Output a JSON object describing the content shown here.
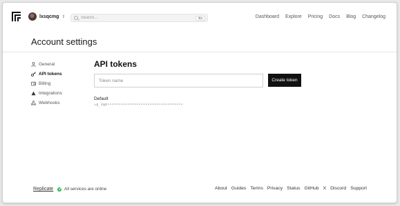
{
  "nav": {
    "username": "lxsqcmg",
    "search_placeholder": "Search...",
    "search_shortcut": "⌘K",
    "links": [
      "Dashboard",
      "Explore",
      "Pricing",
      "Docs",
      "Blog",
      "Changelog"
    ]
  },
  "page": {
    "title": "Account settings"
  },
  "sidebar": {
    "items": [
      {
        "label": "General",
        "icon": "user-icon",
        "active": false
      },
      {
        "label": "API tokens",
        "icon": "key-icon",
        "active": true
      },
      {
        "label": "Billing",
        "icon": "wallet-icon",
        "active": false
      },
      {
        "label": "Integrations",
        "icon": "triangle-icon",
        "active": false
      },
      {
        "label": "Webhooks",
        "icon": "webhook-icon",
        "active": false
      }
    ]
  },
  "main": {
    "section_title": "API tokens",
    "token_input_placeholder": "Token name",
    "create_button_label": "Create token",
    "tokens": [
      {
        "name": "Default",
        "value": "r8_YHP**********************************"
      }
    ]
  },
  "footer": {
    "brand": "Replicate",
    "status_text": "All services are online",
    "status_color": "#2fb455",
    "links": [
      "About",
      "Guides",
      "Terms",
      "Privacy",
      "Status",
      "GitHub",
      "X",
      "Discord",
      "Support"
    ]
  }
}
